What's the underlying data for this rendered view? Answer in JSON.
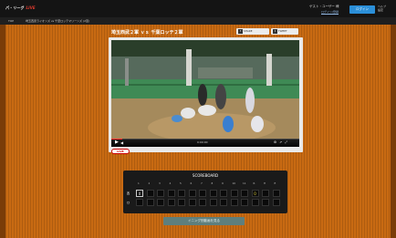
{
  "header": {
    "logo_prefix": "パ・リーグ",
    "logo_brand": "LIVE",
    "user_name": "ゲスト・ユーザー 様",
    "user_link": "ログイン/登録",
    "login_label": "ログイン",
    "extra": [
      "ヘルプ",
      "設定"
    ]
  },
  "breadcrumb": {
    "home": "TOP",
    "path": "埼玉西武ライオンズ vs 千葉ロッテマリーンズ (2軍)"
  },
  "video": {
    "title": "埼玉西武２軍 ｖｓ 千葉ロッテ２軍",
    "share_label": "SHARE",
    "tweet_label": "TWEET",
    "time": "0:00:00",
    "progress_fraction": 0.06,
    "badge": "LIVE"
  },
  "scoreboard": {
    "title": "SCOREBOARD",
    "innings": [
      "1",
      "2",
      "3",
      "4",
      "5",
      "6",
      "7",
      "8",
      "9",
      "10",
      "11",
      "R",
      "H",
      "E"
    ],
    "rows": [
      {
        "team": "西",
        "cells": [
          "0",
          "",
          "",
          "",
          "",
          "",
          "",
          "",
          "",
          "",
          "",
          "0",
          "",
          ""
        ]
      },
      {
        "team": "ロ",
        "cells": [
          "",
          "",
          "",
          "",
          "",
          "",
          "",
          "",
          "",
          "",
          "",
          "",
          "",
          ""
        ]
      }
    ]
  },
  "cta_label": "イニング別動画を見る",
  "colors": {
    "stage": "#c86a12",
    "accent": "#2b8fd8",
    "cta": "#5e7f7d"
  }
}
